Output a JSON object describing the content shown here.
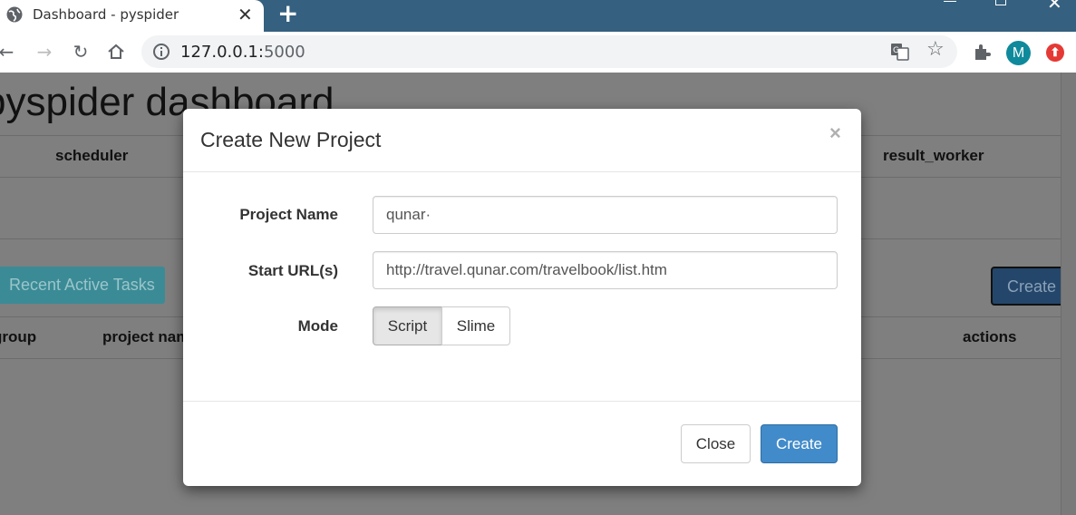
{
  "browser": {
    "tab_title": "Dashboard - pyspider",
    "tab_close": "✕",
    "new_tab": "+",
    "url_host": "127.0.0.1:",
    "url_port": "5000",
    "profile_initial": "M"
  },
  "page": {
    "title": "pyspider dashboard",
    "status_columns": [
      "scheduler",
      "result_worker"
    ],
    "recent_tasks_button": "Recent Active Tasks",
    "create_button": "Create",
    "table_headers": [
      "group",
      "project name",
      "actions"
    ]
  },
  "modal": {
    "title": "Create New Project",
    "close_x": "×",
    "project_name_label": "Project Name",
    "project_name_value": "qunar·",
    "start_urls_label": "Start URL(s)",
    "start_urls_value": "http://travel.qunar.com/travelbook/list.htm",
    "mode_label": "Mode",
    "mode_options": [
      "Script",
      "Slime"
    ],
    "mode_selected": "Script",
    "close_button": "Close",
    "create_button": "Create"
  },
  "colors": {
    "tabbar": "#35607f",
    "primary_button": "#428bca",
    "overlay": "#7f7f7f",
    "avatar": "#0f8a9c"
  }
}
